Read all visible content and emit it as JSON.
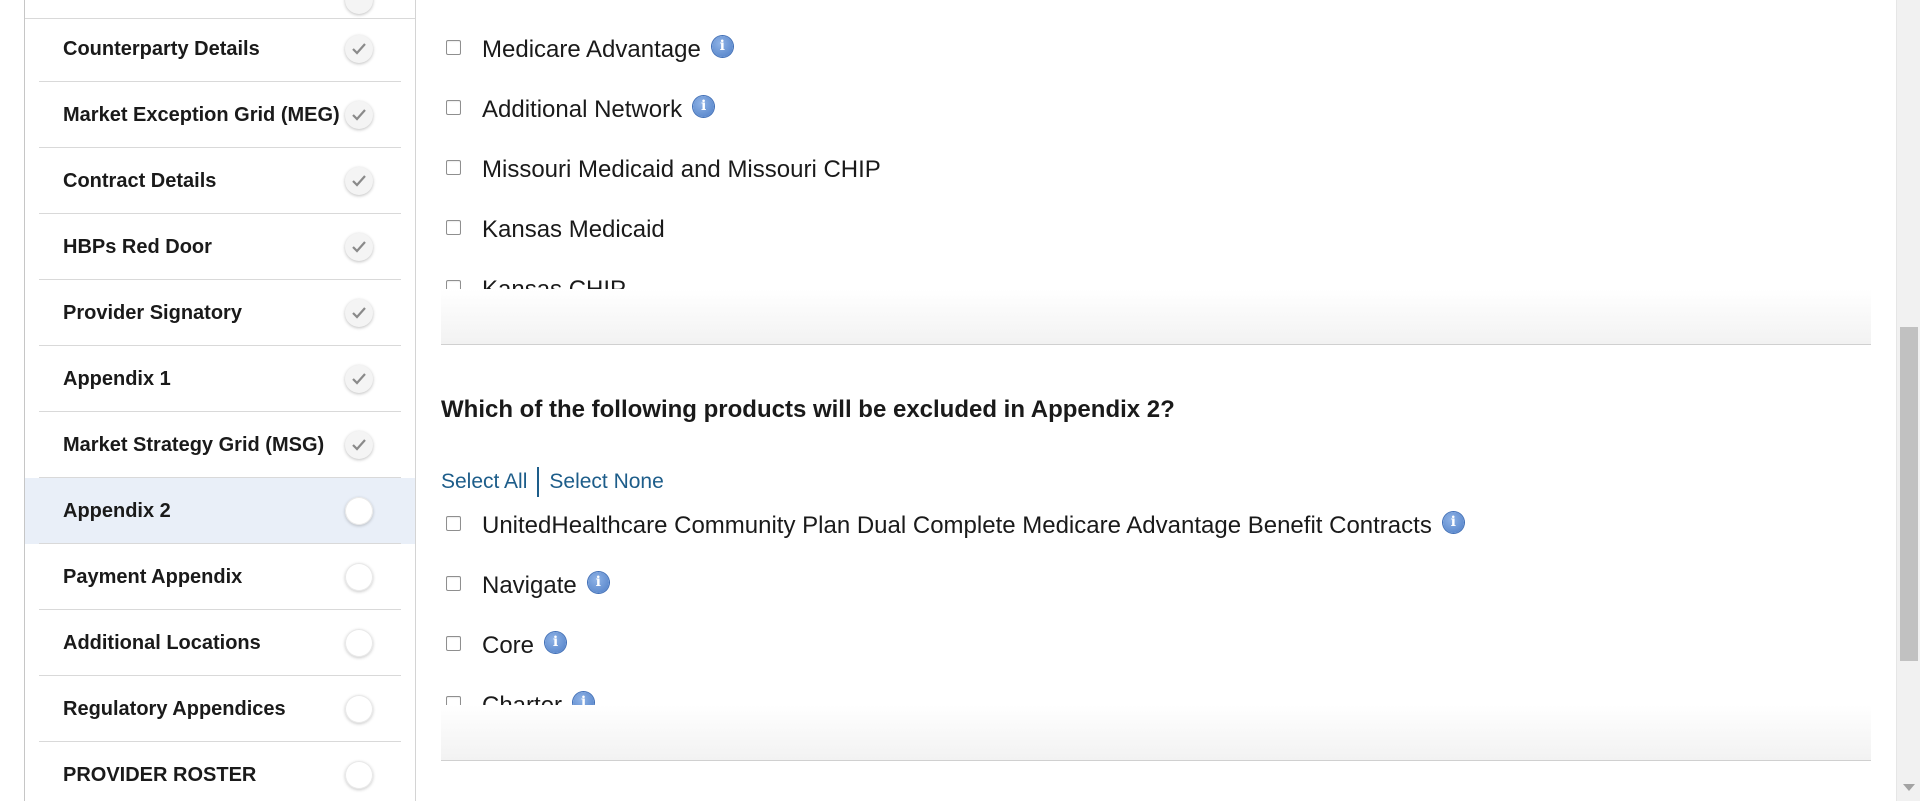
{
  "sidebar": {
    "items": [
      {
        "label": "Counterparty Details",
        "status": "complete"
      },
      {
        "label": "Market Exception Grid (MEG)",
        "status": "complete"
      },
      {
        "label": "Contract Details",
        "status": "complete"
      },
      {
        "label": "HBPs Red Door",
        "status": "complete"
      },
      {
        "label": "Provider Signatory",
        "status": "complete"
      },
      {
        "label": "Appendix 1",
        "status": "complete"
      },
      {
        "label": "Market Strategy Grid (MSG)",
        "status": "complete"
      },
      {
        "label": "Appendix 2",
        "status": "pending",
        "active": true
      },
      {
        "label": "Payment Appendix",
        "status": "pending"
      },
      {
        "label": "Additional Locations",
        "status": "pending"
      },
      {
        "label": "Regulatory Appendices",
        "status": "pending"
      },
      {
        "label": "PROVIDER ROSTER",
        "status": "pending"
      }
    ]
  },
  "section1": {
    "options": [
      {
        "label": "Medicare Advantage",
        "info": true,
        "checked": false
      },
      {
        "label": "Additional Network",
        "info": true,
        "checked": false
      },
      {
        "label": "Missouri Medicaid and Missouri CHIP",
        "info": false,
        "checked": false
      },
      {
        "label": "Kansas Medicaid",
        "info": false,
        "checked": false
      },
      {
        "label": "Kansas CHIP",
        "info": false,
        "checked": false
      }
    ]
  },
  "section2": {
    "question": "Which of the following products will be excluded in Appendix 2?",
    "select_all": "Select All",
    "select_none": "Select None",
    "options": [
      {
        "label": "UnitedHealthcare Community Plan Dual Complete Medicare Advantage Benefit Contracts",
        "info": true,
        "checked": false
      },
      {
        "label": "Navigate",
        "info": true,
        "checked": false
      },
      {
        "label": "Core",
        "info": true,
        "checked": false
      },
      {
        "label": "Charter",
        "info": true,
        "checked": false
      }
    ]
  },
  "icons": {
    "check": "check-icon",
    "info": "info-icon",
    "info_glyph": "i"
  },
  "colors": {
    "link": "#1d5d8a",
    "active_row": "#e9eff8",
    "info_badge": "#4d7dc6"
  }
}
